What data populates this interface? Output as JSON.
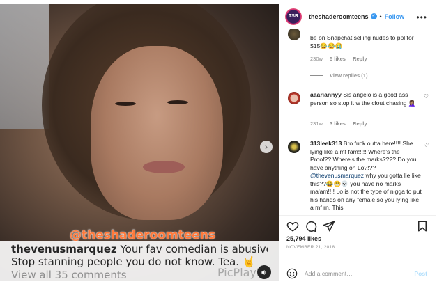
{
  "post": {
    "caption_user": "thevenusmarquez",
    "caption_text": "Your fav comedian is abusive.",
    "caption_line2": "Stop stanning people you do not know. Tea. 🤘",
    "view_all": "View all 35 comments",
    "watermark": "@theshaderoomteens",
    "picplay": "PicPlayPo"
  },
  "header": {
    "avatar_text": "TSR",
    "username": "theshaderoomteens",
    "separator": "•",
    "follow": "Follow"
  },
  "comments": [
    {
      "text": "be on Snapchat selling nudes to ppl for $15😂😂😭",
      "time": "230w",
      "likes": "5 likes",
      "reply": "Reply",
      "view_replies": "View replies (1)"
    },
    {
      "user": "aaariannyy",
      "text": "Sis angelo is a good ass person so stop it w the clout chasing 🤦🏽‍♀️",
      "time": "231w",
      "likes": "3 likes",
      "reply": "Reply"
    },
    {
      "user": "313leek313",
      "text1": "Bro fuck outta here!!!! She lying like a mf fam!!!!! Where's the Proof?? Where's the marks???? Do you have anything on Lo?!??",
      "mention": "@thevenusmarquez",
      "text2": "why you gotta lie like this??😂😬💀 you have no marks ma'am!!!! Lo is not the type of nigga to put his hands on any female so you lying like a mf rn. This"
    }
  ],
  "stats": {
    "likes": "25,794 likes",
    "date": "NOVEMBER 21, 2018"
  },
  "add_comment": {
    "placeholder": "Add a comment…",
    "post": "Post"
  },
  "colors": {
    "accent": "#3897f0",
    "text": "#262626",
    "muted": "#8e8e8e"
  }
}
